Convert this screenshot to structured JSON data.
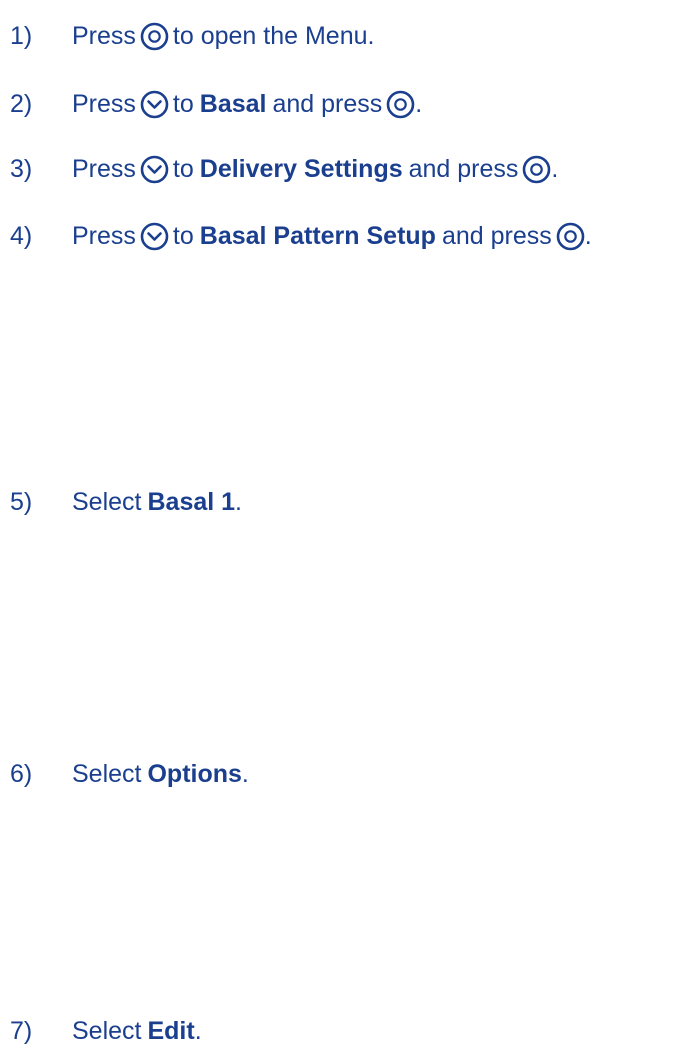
{
  "steps": [
    {
      "number": "1)",
      "press": "Press",
      "select_icon": "select-button-icon",
      "rest": "to open the Menu."
    },
    {
      "number": "2)",
      "press": "Press",
      "down_icon": "down-arrow-button-icon",
      "to": "to",
      "target": "Basal",
      "and_press": "and press",
      "select_icon": "select-button-icon",
      "end": "."
    },
    {
      "number": "3)",
      "press": "Press",
      "down_icon": "down-arrow-button-icon",
      "to": "to",
      "target": "Delivery Settings",
      "and_press": "and press",
      "select_icon": "select-button-icon",
      "end": "."
    },
    {
      "number": "4)",
      "press": "Press",
      "down_icon": "down-arrow-button-icon",
      "to": "to",
      "target": "Basal Pattern Setup",
      "and_press": "and press",
      "select_icon": "select-button-icon",
      "end": "."
    },
    {
      "number": "5)",
      "select": "Select",
      "target": "Basal 1",
      "end": "."
    },
    {
      "number": "6)",
      "select": "Select",
      "target": "Options",
      "end": "."
    },
    {
      "number": "7)",
      "select": "Select",
      "target": "Edit",
      "end": "."
    }
  ],
  "colors": {
    "text": "#1b3f8f"
  }
}
